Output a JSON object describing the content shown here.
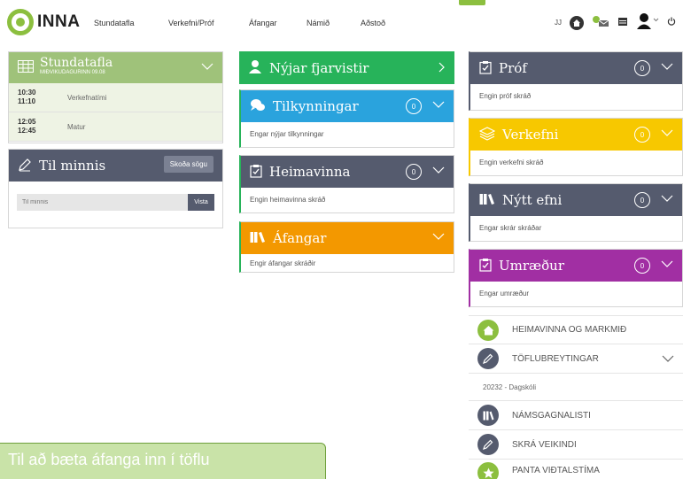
{
  "logo": {
    "text": "INNA"
  },
  "nav": [
    "Stundatafla",
    "Verkefni/Próf",
    "Áfangar",
    "Námið",
    "Aðstoð"
  ],
  "user": {
    "initials": "JJ"
  },
  "stundatafla": {
    "title": "Stundatafla",
    "subtitle": "MIÐVIKUDAGURINN 09.08",
    "rows": [
      {
        "start": "10:30",
        "end": "11:10",
        "name": "Verkefnatími"
      },
      {
        "start": "12:05",
        "end": "12:45",
        "name": "Matur"
      }
    ]
  },
  "til_minnis": {
    "title": "Til minnis",
    "history_button": "Skoða sögu",
    "placeholder": "Til minnis",
    "save_button": "Vista"
  },
  "nyjar_fjarvistir": {
    "title": "Nýjar fjarvistir"
  },
  "tilkynningar": {
    "title": "Tilkynningar",
    "count": "0",
    "empty": "Engar nýjar tilkynningar"
  },
  "heimavinna": {
    "title": "Heimavinna",
    "count": "0",
    "empty": "Engin heimavinna skráð"
  },
  "afangar": {
    "title": "Áfangar",
    "empty": "Engir áfangar skráðir"
  },
  "prof": {
    "title": "Próf",
    "count": "0",
    "empty": "Engin próf skráð"
  },
  "verkefni": {
    "title": "Verkefni",
    "count": "0",
    "empty": "Engin verkefni skráð"
  },
  "nytt_efni": {
    "title": "Nýtt efni",
    "count": "0",
    "empty": "Engar skrár skráðar"
  },
  "umraedur": {
    "title": "Umræður",
    "count": "0",
    "empty": "Engar umræður"
  },
  "menu": {
    "heimavinna": "HEIMAVINNA OG MARKMIÐ",
    "toflubreytingar": "TÖFLUBREYTINGAR",
    "dagskoli": "20232 - Dagskóli",
    "namsgagnalisti": "NÁMSGAGNALISTI",
    "veikindi": "SKRÁ VEIKINDI",
    "vidtalstima": "PANTA VIÐTALSTÍMA"
  },
  "tooltip": {
    "text": "Til að bæta áfanga inn í töflu"
  },
  "colors": {
    "green_light": "#9fc27a",
    "slate": "#555b6e",
    "green": "#27b35a",
    "blue": "#2aa3dd",
    "orange": "#f39800",
    "yellow": "#f7c800",
    "purple": "#a12fa3"
  }
}
